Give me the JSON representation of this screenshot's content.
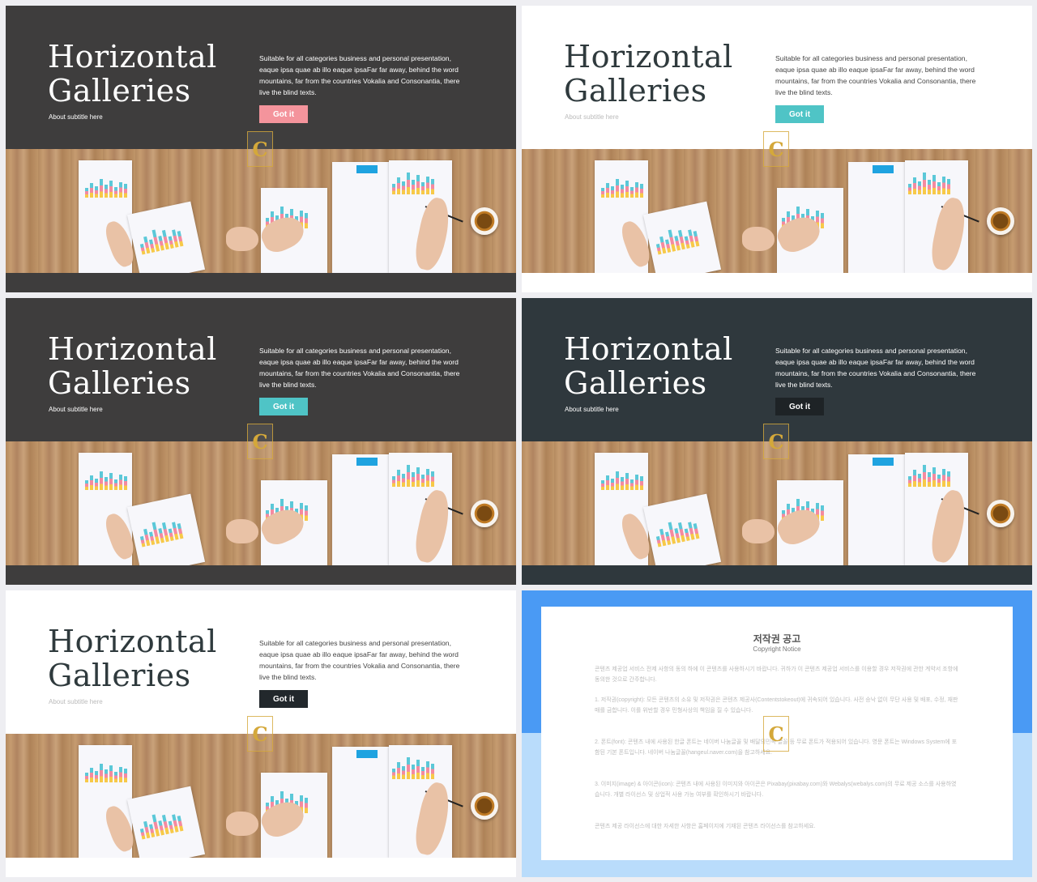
{
  "slides": [
    {
      "title_line1": "Horizontal",
      "title_line2": "Galleries",
      "subtitle": "About subtitle here",
      "description": "Suitable for all categories business and personal presentation, eaque ipsa quae ab illo eaque ipsaFar far away, behind the word mountains, far from the countries Vokalia and Consonantia, there live the blind texts.",
      "button_label": "Got it",
      "theme": {
        "background": "#3e3d3d",
        "title": "#ffffff",
        "text": "#ffffff",
        "subtitle": "#ffffff",
        "button": "#f4949c",
        "band": "#3e3d3d"
      }
    },
    {
      "title_line1": "Horizontal",
      "title_line2": "Galleries",
      "subtitle": "About subtitle here",
      "description": "Suitable for all categories business and personal presentation, eaque ipsa quae ab illo eaque ipsaFar far away, behind the word mountains, far from the countries Vokalia and Consonantia, there live the blind texts.",
      "button_label": "Got it",
      "theme": {
        "background": "#ffffff",
        "title": "#2f3a3d",
        "text": "#444444",
        "subtitle": "#bbbbbb",
        "button": "#4fc4c6",
        "band": "#ffffff"
      }
    },
    {
      "title_line1": "Horizontal",
      "title_line2": "Galleries",
      "subtitle": "About subtitle here",
      "description": "Suitable for all categories business and personal presentation, eaque ipsa quae ab illo eaque ipsaFar far away, behind the word mountains, far from the countries Vokalia and Consonantia, there live the blind texts.",
      "button_label": "Got it",
      "theme": {
        "background": "#3e3d3d",
        "title": "#ffffff",
        "text": "#ffffff",
        "subtitle": "#ffffff",
        "button": "#4fc4c6",
        "band": "#3e3d3d"
      }
    },
    {
      "title_line1": "Horizontal",
      "title_line2": "Galleries",
      "subtitle": "About subtitle here",
      "description": "Suitable for all categories business and personal presentation, eaque ipsa quae ab illo eaque ipsaFar far away, behind the word mountains, far from the countries Vokalia and Consonantia, there live the blind texts.",
      "button_label": "Got it",
      "theme": {
        "background": "#2f383d",
        "title": "#ffffff",
        "text": "#ffffff",
        "subtitle": "#ffffff",
        "button": "#1e2326",
        "band": "#2f383d"
      }
    },
    {
      "title_line1": "Horizontal",
      "title_line2": "Galleries",
      "subtitle": "About subtitle here",
      "description": "Suitable for all categories business and personal presentation, eaque ipsa quae ab illo eaque ipsaFar far away, behind the word mountains, far from the countries Vokalia and Consonantia, there live the blind texts.",
      "button_label": "Got it",
      "theme": {
        "background": "#ffffff",
        "title": "#2f3a3d",
        "text": "#444444",
        "subtitle": "#bbbbbb",
        "button": "#22282c",
        "band": "#ffffff"
      }
    }
  ],
  "notice": {
    "title": "저작권 공고",
    "subtitle": "Copyright Notice",
    "paragraphs": [
      "콘텐츠 제공업 서비스 전제 사항의 동의 하에 이 콘텐츠를 사용하시기 바랍니다. 귀하가 이 콘텐츠 제공업 서비스를 이용할 경우 저작권에 관한 계약서 조항에 동의한 것으로 간주합니다.",
      "1. 저작권(copyright): 모든 콘텐츠의 소유 및 저작권은 콘텐츠 제공사(Contentstokeout)에 귀속되어 있습니다. 사전 승낙 없이 무단 사용 및 배포, 수정, 재판매를 금합니다. 이를 위반할 경우 민형사상의 책임을 질 수 있습니다.",
      "2. 폰트(font): 콘텐츠 내에 사용된 한글 폰트는 네이버 나눔글꼴 및 배달의민족 글꼴 등 무료 폰트가 적용되어 있습니다. 영문 폰트는 Windows System에 포함된 기본 폰트입니다. 네이버 나눔글꼴(hangeul.naver.com)을 참고하세요.",
      "3. 이미지(image) & 아이콘(icon): 콘텐츠 내에 사용된 이미지와 아이콘은 Pixabay(pixabay.com)와 Webalys(webalys.com)의 무료 제공 소스를 사용하였습니다. 개별 라이선스 및 상업적 사용 가능 여부를 확인하시기 바랍니다.",
      "콘텐츠 제공 라이선스에 대한 자세한 사항은 홈페이지에 기재된 콘텐츠 라이선스를 참고하세요."
    ]
  },
  "watermark": {
    "letter": "C",
    "color": "#d4a83a"
  },
  "chart_colors": [
    "#5bc8d8",
    "#f48aa0",
    "#f7c948",
    "#6ec6e8"
  ]
}
